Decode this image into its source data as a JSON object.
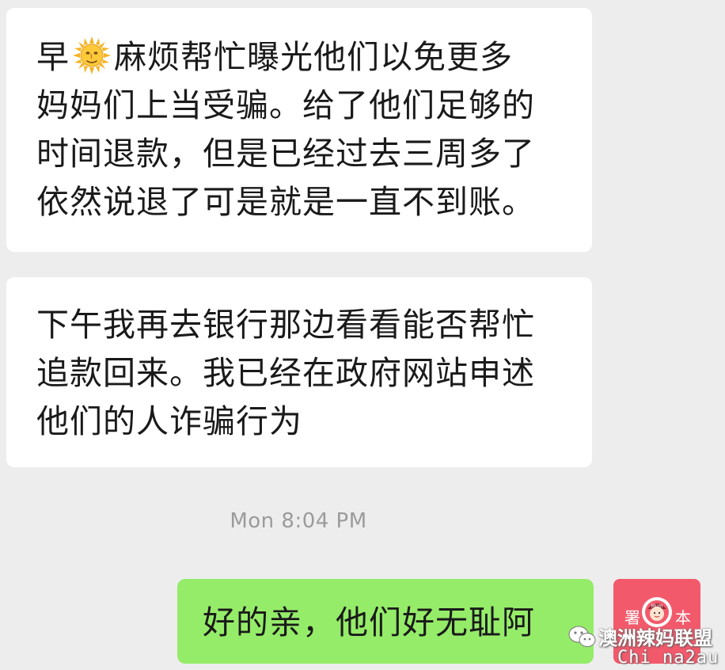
{
  "conversation": {
    "messages": [
      {
        "id": "msg1",
        "sender": "other",
        "lines": [
          {
            "before_icon": "早",
            "icon": "sun-with-face-icon",
            "after_icon": "麻烦帮忙曝光他们以免更多"
          },
          "妈妈们上当受骗。给了他们足够的",
          "时间退款，但是已经过去三周多了",
          "依然说退了可是就是一直不到账。"
        ]
      },
      {
        "id": "msg2",
        "sender": "other",
        "lines": [
          "下午我再去银行那边看看能否帮忙",
          "追款回来。我已经在政府网站申述",
          "他们的人诈骗行为"
        ]
      }
    ],
    "timestamp": "Mon 8:04 PM",
    "reply": {
      "sender": "self",
      "text": "好的亲，他们好无耻阿"
    }
  },
  "avatar": {
    "left_char": "署",
    "right_char": "本",
    "badge": "Mum"
  },
  "watermark": {
    "title": "澳洲辣妈联盟",
    "subtitle": "Chi na2au"
  },
  "colors": {
    "background": "#ededed",
    "incoming_bubble": "#ffffff",
    "outgoing_bubble": "#95ec69",
    "avatar_bg": "#f25a6c",
    "timestamp_text": "#9b9b9b"
  }
}
